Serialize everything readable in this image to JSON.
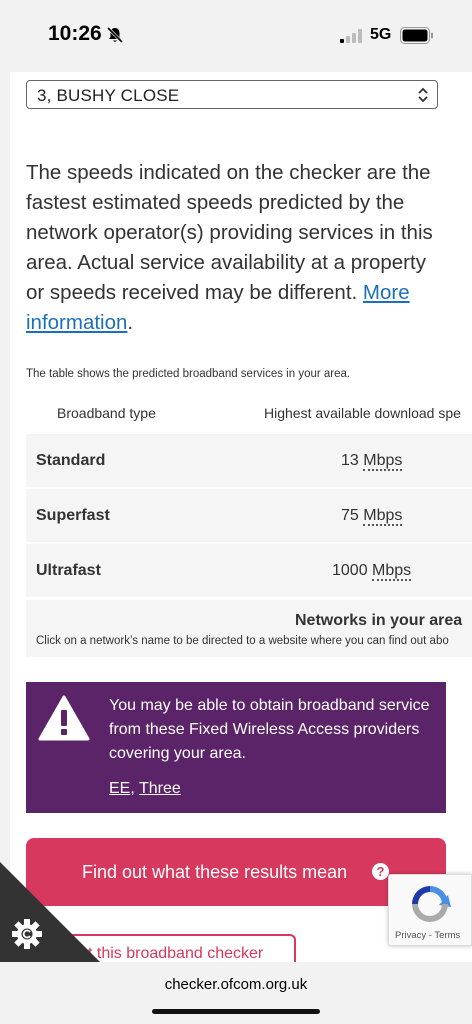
{
  "status_bar": {
    "time": "10:26",
    "network": "5G"
  },
  "address_select": {
    "value": "3, BUSHY CLOSE"
  },
  "disclaimer": {
    "text": "The speeds indicated on the checker are the fastest estimated speeds predicted by the network operator(s) providing services in this area. Actual service availability at a property or speeds received may be different. ",
    "link": "More information",
    "end": "."
  },
  "table": {
    "caption": "The table shows the predicted broadband services in your area.",
    "headers": [
      "Broadband type",
      "Highest available download spe"
    ],
    "rows": [
      {
        "type": "Standard",
        "speed": "13",
        "unit": "Mbps"
      },
      {
        "type": "Superfast",
        "speed": "75",
        "unit": "Mbps"
      },
      {
        "type": "Ultrafast",
        "speed": "1000",
        "unit": "Mbps"
      }
    ]
  },
  "networks": {
    "title": "Networks in your area",
    "subtitle": "Click on a network’s name to be directed to a website where you can find out abo"
  },
  "fwa_notice": {
    "message": "You may be able to obtain broadband service from these Fixed Wireless Access providers covering your area.",
    "providers": [
      "EE",
      "Three"
    ],
    "separator": ", ",
    "bg_color": "#5b2468"
  },
  "buttons": {
    "results": "Find out what these results mean",
    "results_icon": "?",
    "about": "t this broadband checker",
    "accent_color": "#d7385e"
  },
  "recaptcha": {
    "terms": "Privacy - Terms"
  },
  "url_bar": {
    "url": "checker.ofcom.org.uk"
  }
}
